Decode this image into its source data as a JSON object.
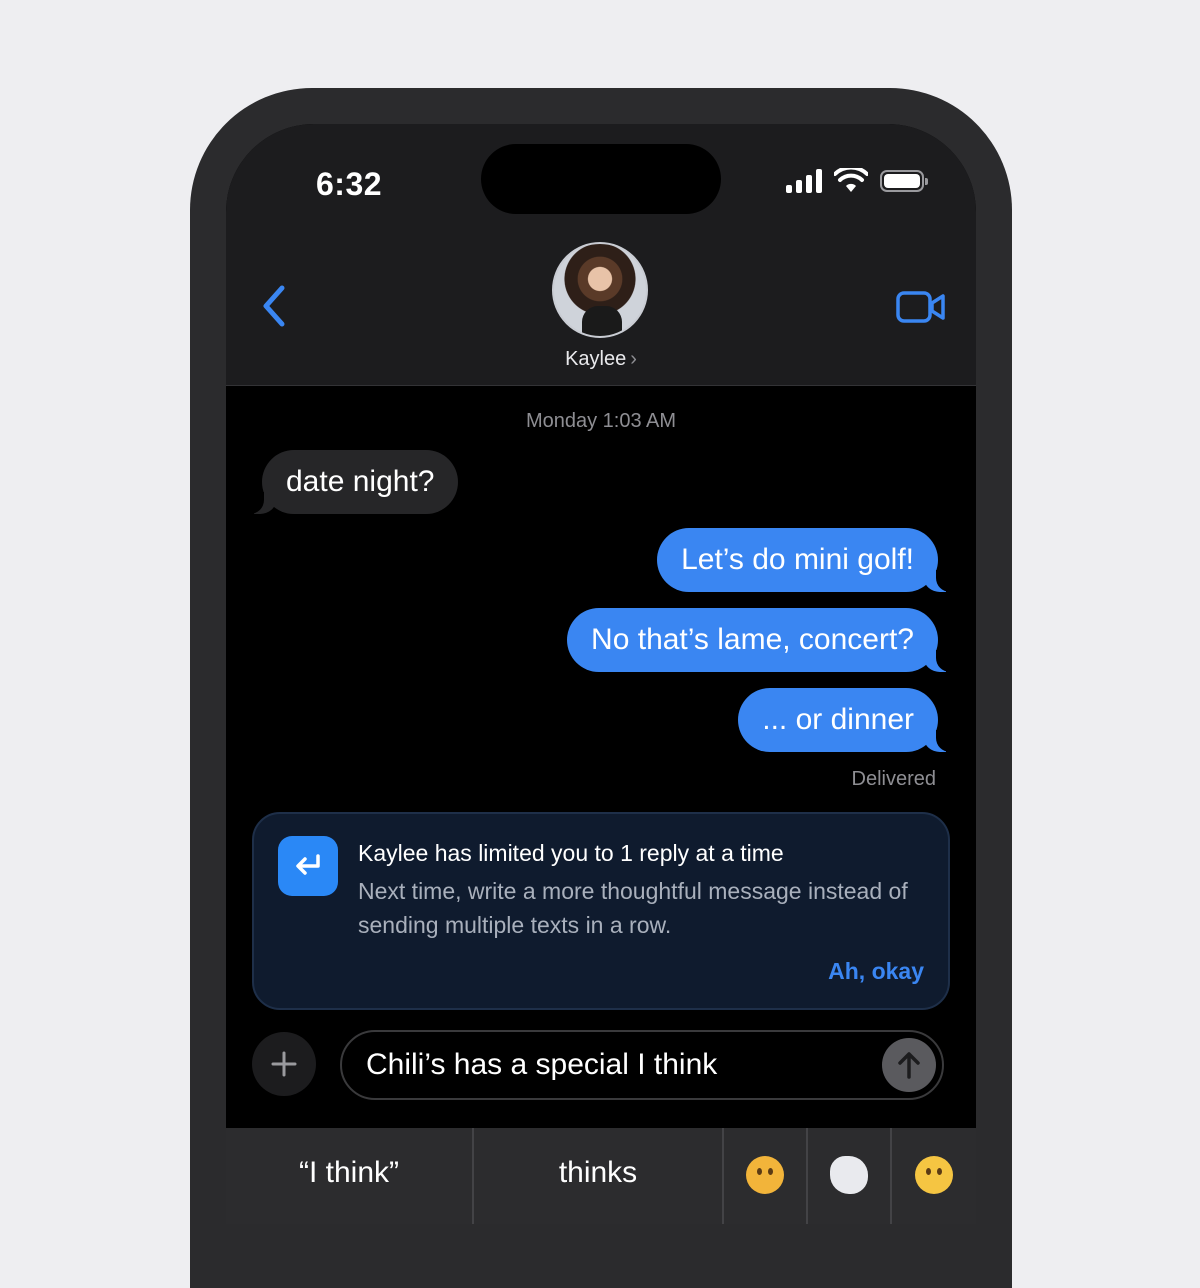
{
  "status_bar": {
    "time": "6:32"
  },
  "header": {
    "contact_name": "Kaylee",
    "contact_chevron": "›"
  },
  "conversation": {
    "timestamp": "Monday 1:03 AM",
    "messages": [
      {
        "direction": "incoming",
        "text": "date night?"
      },
      {
        "direction": "outgoing",
        "text": "Let’s do mini golf!"
      },
      {
        "direction": "outgoing",
        "text": "No that’s lame, concert?"
      },
      {
        "direction": "outgoing",
        "text": "... or dinner"
      }
    ],
    "delivered_label": "Delivered"
  },
  "notice": {
    "title": "Kaylee has limited you to 1 reply at a time",
    "body": "Next time, write a more thoughtful message instead of sending multiple texts in a row.",
    "action_label": "Ah, okay",
    "icon": "reply-arrow-icon"
  },
  "composer": {
    "text": "Chili’s has a special I think",
    "plus_icon": "plus-icon",
    "send_icon": "arrow-up-icon"
  },
  "suggestions": {
    "words": [
      "“I think”",
      "thinks"
    ],
    "emojis": [
      "thinking-face-emoji",
      "thought-balloon-emoji",
      "face-with-monocle-emoji"
    ]
  },
  "colors": {
    "accent": "#3a86f2",
    "incoming_bubble": "#262628",
    "notice_bg": "#0f1b2e"
  }
}
